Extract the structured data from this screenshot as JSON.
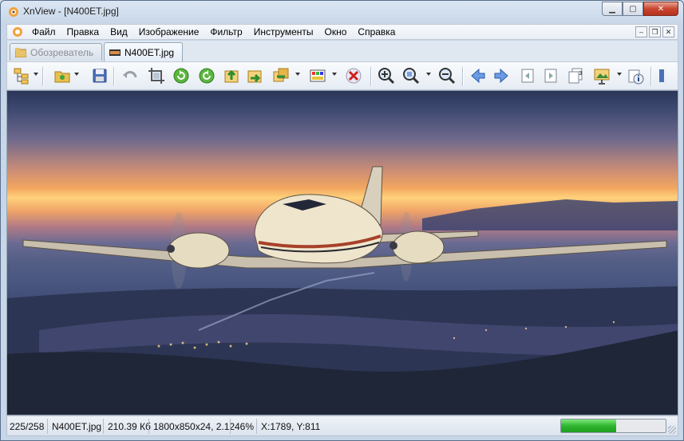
{
  "window": {
    "title": "XnView - [N400ET.jpg]",
    "minimize_icon": "minimize-icon",
    "maximize_icon": "maximize-icon",
    "close_icon": "close-icon"
  },
  "menu": {
    "items": [
      "Файл",
      "Правка",
      "Вид",
      "Изображение",
      "Фильтр",
      "Инструменты",
      "Окно",
      "Справка"
    ]
  },
  "tabs": [
    {
      "label": "Обозреватель",
      "active": false
    },
    {
      "label": "N400ET.jpg",
      "active": true
    }
  ],
  "toolbar": {
    "buttons": [
      "browser-tree-icon",
      "open-folder-icon",
      "save-icon",
      "undo-icon",
      "crop-icon",
      "rotate-left-icon",
      "rotate-right-icon",
      "export-icon",
      "share-icon",
      "convert-icon",
      "color-palette-icon",
      "delete-icon",
      "zoom-in-icon",
      "zoom-fit-icon",
      "zoom-out-icon",
      "previous-icon",
      "next-icon",
      "first-image-icon",
      "last-image-icon",
      "multi-page-icon",
      "slideshow-icon",
      "properties-icon"
    ]
  },
  "status": {
    "index": "225/258",
    "filename": "N400ET.jpg",
    "filesize": "210.39 Кб",
    "dimensions": "1800x850x24, 2.12",
    "zoom": "46%",
    "coords": "X:1789, Y:811",
    "progress": 0.53
  },
  "colors": {
    "progress_green": "#2fb62f",
    "close_red": "#c9452f"
  }
}
